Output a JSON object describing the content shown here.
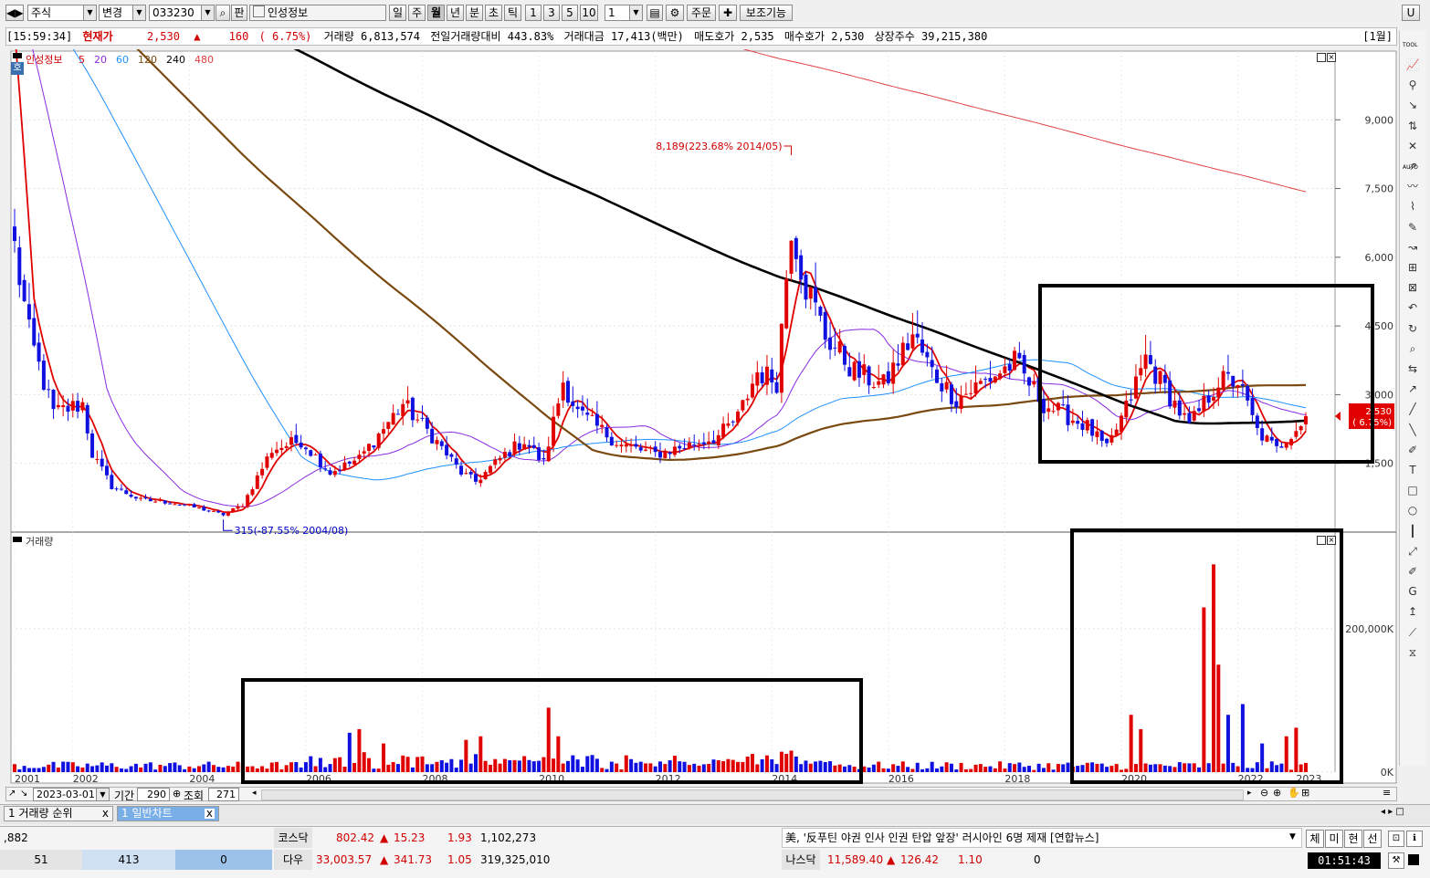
{
  "toolbar": {
    "market": "주식",
    "change_btn": "변경",
    "code": "033230",
    "pan_btn": "판",
    "stock_name": "인성정보",
    "period_btns": [
      "일",
      "주",
      "월",
      "년",
      "분",
      "초",
      "틱"
    ],
    "active_period": "월",
    "num_btns": [
      "1",
      "3",
      "5",
      "10"
    ],
    "interval_value": "1",
    "order_btn": "주문",
    "aux_btn": "보조기능"
  },
  "quote": {
    "time": "[15:59:34]",
    "price_label": "현재가",
    "price": "2,530",
    "arrow": "▲",
    "change": "160",
    "change_pct": "( 6.75%)",
    "volume_label": "거래량",
    "volume": "6,813,574",
    "prev_ratio_label": "전일거래량대비",
    "prev_ratio": "443.83%",
    "amount_label": "거래대금",
    "amount": "17,413(백만)",
    "ask_label": "매도호가",
    "ask": "2,535",
    "bid_label": "매수호가",
    "bid": "2,530",
    "shares_label": "상장주수",
    "shares": "39,215,380",
    "period_tag": "[1월]"
  },
  "price_legend": {
    "name": "인성정보",
    "ma": [
      {
        "label": "5",
        "color": "#e00000"
      },
      {
        "label": "20",
        "color": "#8a2be2"
      },
      {
        "label": "60",
        "color": "#1e90ff"
      },
      {
        "label": "120",
        "color": "#7a4a10"
      },
      {
        "label": "240",
        "color": "#000000"
      },
      {
        "label": "480",
        "color": "#e04040"
      }
    ],
    "corner_badge": "호"
  },
  "volume_legend": {
    "name": "거래량"
  },
  "chart_data": [
    {
      "type": "candlestick",
      "frequency": "monthly",
      "x_range": [
        "2001-01",
        "2023-03"
      ],
      "x_ticks": [
        "2001",
        "2002",
        "2004",
        "2006",
        "2008",
        "2010",
        "2012",
        "2014",
        "2016",
        "2018",
        "2020",
        "2022",
        "2023"
      ],
      "y_ticks": [
        "1,500",
        "3,000",
        "4,500",
        "6,000",
        "7,500",
        "9,000"
      ],
      "ylim": [
        0,
        10500
      ],
      "annotations": {
        "high": "8,189(223.68% 2014/05)",
        "low": "315(-87.55% 2004/08)",
        "last_price": "2,530",
        "last_pct": "( 6.75%)"
      },
      "up_color": "#e00000",
      "down_color": "#1010e0",
      "anchors": [
        [
          "2001-01",
          6200
        ],
        [
          "2001-04",
          4300
        ],
        [
          "2001-09",
          2600
        ],
        [
          "2002-03",
          2800
        ],
        [
          "2002-05",
          1700
        ],
        [
          "2002-09",
          1000
        ],
        [
          "2003-03",
          700
        ],
        [
          "2003-09",
          650
        ],
        [
          "2004-03",
          520
        ],
        [
          "2004-08",
          380
        ],
        [
          "2004-12",
          600
        ],
        [
          "2005-06",
          1800
        ],
        [
          "2005-12",
          2000
        ],
        [
          "2006-06",
          1300
        ],
        [
          "2006-12",
          1600
        ],
        [
          "2007-03",
          2000
        ],
        [
          "2007-09",
          2800
        ],
        [
          "2008-03",
          2100
        ],
        [
          "2008-09",
          1300
        ],
        [
          "2008-12",
          1100
        ],
        [
          "2009-06",
          1700
        ],
        [
          "2009-10",
          2000
        ],
        [
          "2010-02",
          1500
        ],
        [
          "2010-06",
          3300
        ],
        [
          "2010-09",
          2600
        ],
        [
          "2011-06",
          1900
        ],
        [
          "2012-01",
          1700
        ],
        [
          "2012-08",
          1900
        ],
        [
          "2013-02",
          2100
        ],
        [
          "2013-06",
          2500
        ],
        [
          "2013-10",
          3500
        ],
        [
          "2014-02",
          3300
        ],
        [
          "2014-05",
          6800
        ],
        [
          "2014-08",
          5400
        ],
        [
          "2014-12",
          4300
        ],
        [
          "2015-06",
          3500
        ],
        [
          "2015-12",
          3200
        ],
        [
          "2016-06",
          4300
        ],
        [
          "2016-10",
          3500
        ],
        [
          "2017-03",
          2900
        ],
        [
          "2017-09",
          3300
        ],
        [
          "2018-03",
          3700
        ],
        [
          "2018-09",
          2800
        ],
        [
          "2019-06",
          2300
        ],
        [
          "2019-10",
          1800
        ],
        [
          "2020-02",
          2700
        ],
        [
          "2020-06",
          3800
        ],
        [
          "2020-12",
          2800
        ],
        [
          "2021-03",
          2300
        ],
        [
          "2021-09",
          3300
        ],
        [
          "2022-01",
          3300
        ],
        [
          "2022-05",
          2200
        ],
        [
          "2022-09",
          1800
        ],
        [
          "2023-01",
          2300
        ],
        [
          "2023-02",
          2370
        ],
        [
          "2023-03",
          2530
        ]
      ]
    },
    {
      "type": "bar",
      "series": [
        {
          "name": "거래량"
        }
      ],
      "y_ticks": [
        "0K",
        "200,000K"
      ],
      "ylim": [
        0,
        330000
      ],
      "spikes_k": [
        [
          "2006-10",
          55000
        ],
        [
          "2006-12",
          60000
        ],
        [
          "2007-05",
          40000
        ],
        [
          "2008-10",
          45000
        ],
        [
          "2009-01",
          50000
        ],
        [
          "2010-03",
          90000
        ],
        [
          "2010-05",
          50000
        ],
        [
          "2014-05",
          30000
        ],
        [
          "2020-03",
          80000
        ],
        [
          "2020-05",
          60000
        ],
        [
          "2021-06",
          230000
        ],
        [
          "2021-08",
          290000
        ],
        [
          "2021-09",
          150000
        ],
        [
          "2021-11",
          80000
        ],
        [
          "2022-02",
          95000
        ],
        [
          "2022-06",
          40000
        ],
        [
          "2022-11",
          50000
        ],
        [
          "2023-01",
          62000
        ]
      ]
    }
  ],
  "bottom_nav": {
    "date": "2023-03-01",
    "period_label": "기간",
    "period_value": "290",
    "lookup_label": "조회",
    "lookup_value": "271"
  },
  "tabs": [
    {
      "num": "1",
      "label": "거래량 순위",
      "close": "x"
    },
    {
      "num": "1",
      "label": "일반차트",
      "close": "x"
    }
  ],
  "ticker": {
    "left_value": ",882",
    "left_counts": [
      "51",
      "413",
      "0"
    ],
    "row1": [
      {
        "name": "코스닥",
        "value": "802.42",
        "arrow": "▲",
        "change": "15.23",
        "pct": "1.93",
        "vol": "1,102,273"
      }
    ],
    "row2": [
      {
        "name": "다우",
        "value": "33,003.57",
        "arrow": "▲",
        "change": "341.73",
        "pct": "1.05",
        "vol": "319,325,010"
      }
    ],
    "news": "美, '反푸틴 야권 인사 인권 탄압 앞장' 러시아인 6명 제재 [연합뉴스]",
    "nasdaq": {
      "name": "나스닥",
      "value": "11,589.40",
      "arrow": "▲",
      "change": "126.42",
      "pct": "1.10",
      "vol": "0"
    },
    "quick_btns": [
      "체",
      "미",
      "현",
      "선"
    ],
    "clock": "01:51:43"
  },
  "right_toolbar": {
    "top_label": "TOOL",
    "auto_label": "AUTO",
    "text_tool": "T"
  }
}
